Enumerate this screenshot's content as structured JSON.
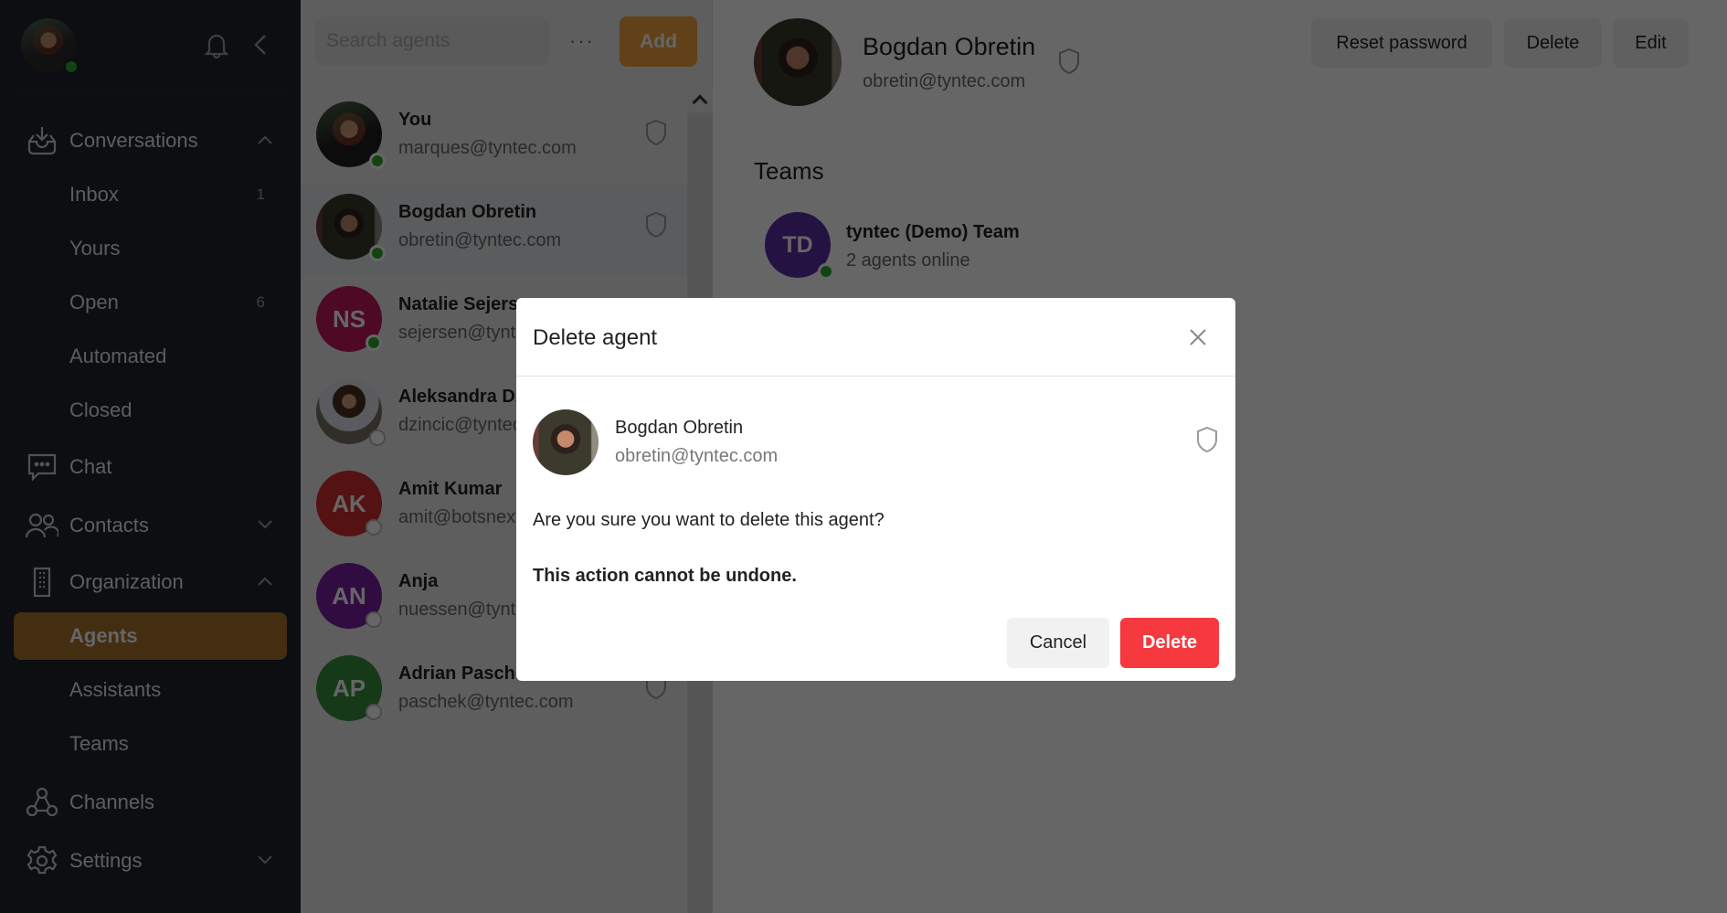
{
  "sidebar": {
    "current_user_status": "online",
    "nav": {
      "conversations": {
        "label": "Conversations",
        "expanded": true,
        "items": [
          {
            "label": "Inbox",
            "count": "1"
          },
          {
            "label": "Yours",
            "count": ""
          },
          {
            "label": "Open",
            "count": "6"
          },
          {
            "label": "Automated",
            "count": ""
          },
          {
            "label": "Closed",
            "count": ""
          }
        ]
      },
      "chat": {
        "label": "Chat"
      },
      "contacts": {
        "label": "Contacts",
        "expanded": false
      },
      "organization": {
        "label": "Organization",
        "expanded": true,
        "items": [
          {
            "label": "Agents",
            "active": true
          },
          {
            "label": "Assistants"
          },
          {
            "label": "Teams"
          }
        ]
      },
      "channels": {
        "label": "Channels"
      },
      "settings": {
        "label": "Settings",
        "expanded": false
      }
    },
    "active_color": "#a8742f"
  },
  "agent_list": {
    "search_placeholder": "Search agents",
    "more_label": "···",
    "add_label": "Add",
    "agents": [
      {
        "name": "You",
        "email": "marques@tyntec.com",
        "initials": "",
        "status": "online",
        "selected": false
      },
      {
        "name": "Bogdan Obretin",
        "email": "obretin@tyntec.com",
        "initials": "",
        "status": "online",
        "selected": true
      },
      {
        "name": "Natalie Sejersen",
        "email": "sejersen@tyntec.com",
        "initials": "NS",
        "color": "#c2185b",
        "status": "online"
      },
      {
        "name": "Aleksandra Dzincic",
        "email": "dzincic@tyntec.com",
        "initials": "",
        "status": "offline"
      },
      {
        "name": "Amit Kumar",
        "email": "amit@botsnext.com",
        "initials": "AK",
        "color": "#d32f2f",
        "status": "offline"
      },
      {
        "name": "Anja",
        "email": "nuessen@tyntec.com",
        "initials": "AN",
        "color": "#7b1fa2",
        "status": "offline"
      },
      {
        "name": "Adrian Paschek",
        "email": "paschek@tyntec.com",
        "initials": "AP",
        "color": "#388e3c",
        "status": "offline"
      }
    ]
  },
  "detail": {
    "name": "Bogdan Obretin",
    "email": "obretin@tyntec.com",
    "buttons": {
      "reset_password": "Reset password",
      "delete": "Delete",
      "edit": "Edit"
    },
    "teams_heading": "Teams",
    "teams": [
      {
        "initials": "TD",
        "name": "tyntec (Demo) Team",
        "subtitle": "2 agents online",
        "color": "#5b2fa8"
      }
    ]
  },
  "modal": {
    "title": "Delete agent",
    "agent_name": "Bogdan Obretin",
    "agent_email": "obretin@tyntec.com",
    "question": "Are you sure you want to delete this agent?",
    "warning": "This action cannot be undone.",
    "cancel_label": "Cancel",
    "delete_label": "Delete",
    "delete_color": "#f5393f"
  }
}
